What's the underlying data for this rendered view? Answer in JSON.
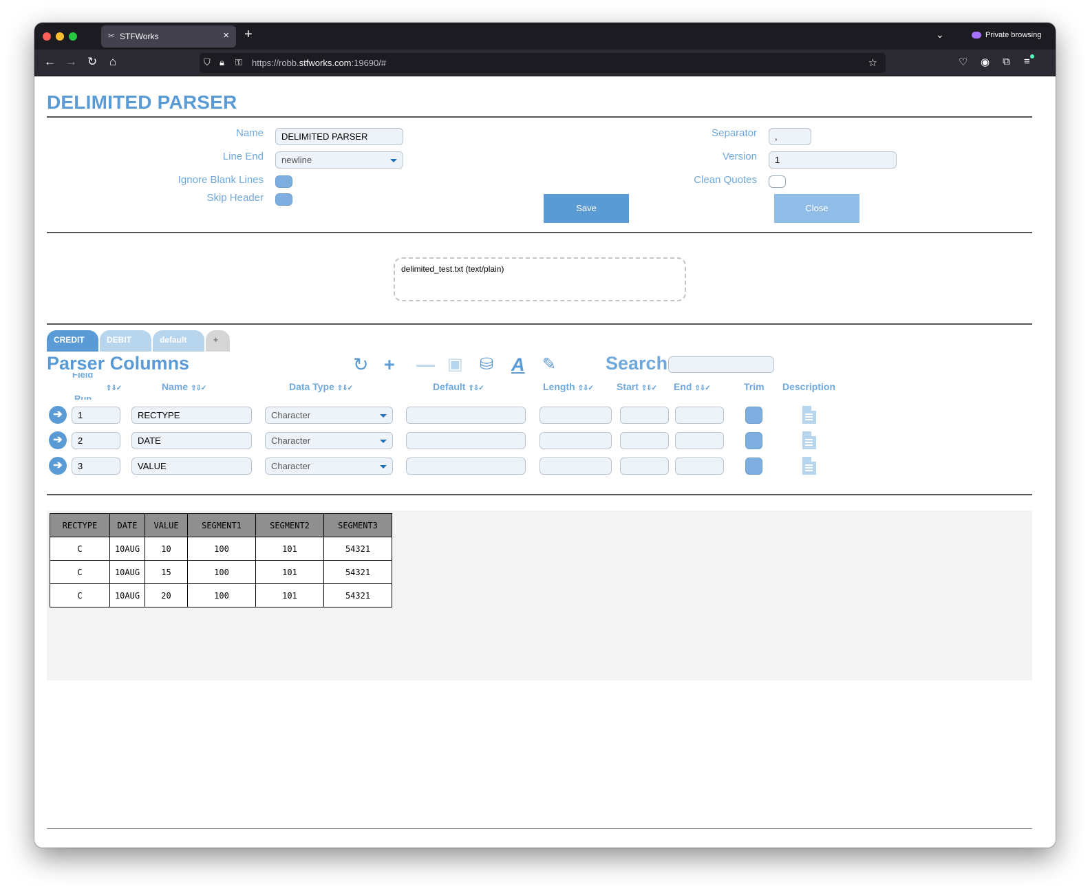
{
  "browser": {
    "tab_title": "STFWorks",
    "url_prefix": "https://robb.",
    "url_domain": "stfworks.com",
    "url_suffix": ":19690/#",
    "private_label": "Private browsing"
  },
  "page": {
    "title": "DELIMITED PARSER",
    "form": {
      "name_label": "Name",
      "name_value": "DELIMITED PARSER",
      "line_end_label": "Line End",
      "line_end_value": "newline",
      "ignore_blank_label": "Ignore Blank Lines",
      "skip_header_label": "Skip Header",
      "separator_label": "Separator",
      "separator_value": ",",
      "version_label": "Version",
      "version_value": "1",
      "clean_quotes_label": "Clean Quotes",
      "save_label": "Save",
      "close_label": "Close"
    },
    "file": "delimited_test.txt (text/plain)",
    "tabs": [
      {
        "label": "CREDIT"
      },
      {
        "label": "DEBIT"
      },
      {
        "label": "default"
      },
      {
        "label": "+"
      }
    ],
    "columns_title": "Parser Columns",
    "search_label": "Search",
    "headers": {
      "field": "Field",
      "run": "Run",
      "sort_icons": "⇧⇩✓",
      "name": "Name",
      "data_type": "Data Type",
      "default": "Default",
      "length": "Length",
      "start": "Start",
      "end": "End",
      "trim": "Trim",
      "description": "Description"
    },
    "rows": [
      {
        "run": "1",
        "name": "RECTYPE",
        "data_type": "Character"
      },
      {
        "run": "2",
        "name": "DATE",
        "data_type": "Character"
      },
      {
        "run": "3",
        "name": "VALUE",
        "data_type": "Character"
      }
    ],
    "preview": {
      "columns": [
        "RECTYPE",
        "DATE",
        "VALUE",
        "SEGMENT1",
        "SEGMENT2",
        "SEGMENT3"
      ],
      "rows": [
        [
          "C",
          "10AUG",
          "10",
          "100",
          "101",
          "54321"
        ],
        [
          "C",
          "10AUG",
          "15",
          "100",
          "101",
          "54321"
        ],
        [
          "C",
          "10AUG",
          "20",
          "100",
          "101",
          "54321"
        ]
      ]
    }
  },
  "colors": {
    "accent": "#5b9bd5",
    "accent_light": "#b8d5ee",
    "label": "#6fa8dc"
  }
}
